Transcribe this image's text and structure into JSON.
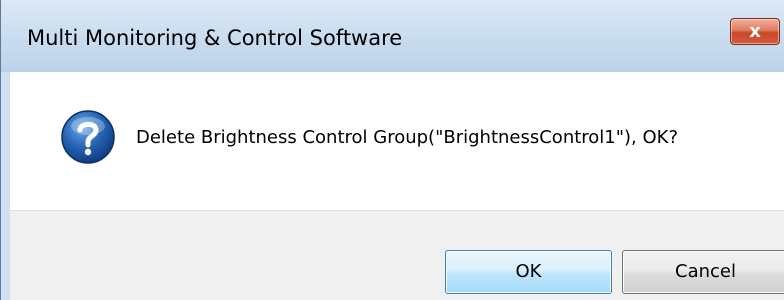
{
  "window": {
    "title": "Multi Monitoring & Control Software",
    "close_glyph": "x",
    "close_icon": "close-icon"
  },
  "message": {
    "icon": "question-icon",
    "text": "Delete Brightness Control Group(\"BrightnessControl1\"), OK?"
  },
  "buttons": {
    "ok_label": "OK",
    "cancel_label": "Cancel"
  },
  "colors": {
    "titlebar": "#c9dcef",
    "close_button": "#c7482a",
    "ok_border": "#3c7fb1",
    "question_icon": "#1f5ea8",
    "footer": "#f0f0f0"
  }
}
